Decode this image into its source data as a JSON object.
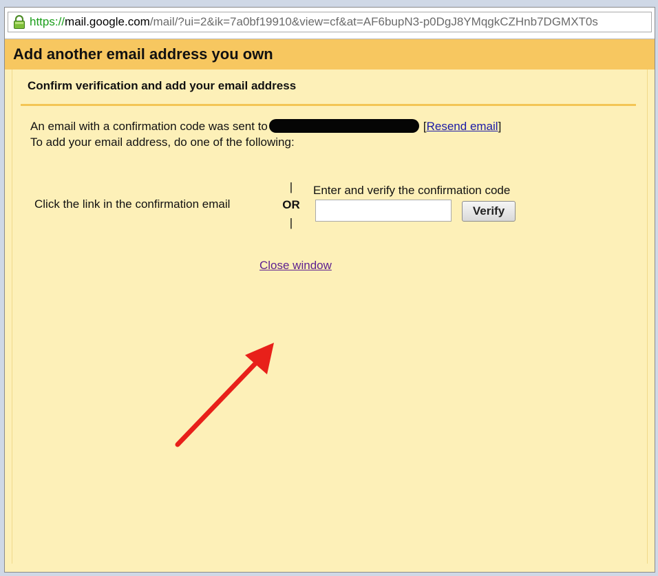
{
  "browser": {
    "url_scheme": "https",
    "url_sep": "://",
    "url_host": "mail.google.com",
    "url_rest": "/mail/?ui=2&ik=7a0bf19910&view=cf&at=AF6bupN3-p0DgJ8YMqgkCZHnb7DGMXT0s",
    "lock_icon": "padlock-icon"
  },
  "dialog": {
    "title": "Add another email address you own",
    "section_title": "Confirm verification and add your email address",
    "message_prefix": "An email with a confirmation code was sent to",
    "resend_open": "[",
    "resend_label": "Resend email",
    "resend_close": "]",
    "instructions": "To add your email address, do one of the following:",
    "option_link_text": "Click the link in the confirmation email",
    "or_bar": "|",
    "or_label": "OR",
    "option_code_text": "Enter and verify the confirmation code",
    "code_input_value": "",
    "verify_label": "Verify",
    "close_label": "Close window"
  },
  "colors": {
    "titlebar": "#f7c760",
    "background": "#fdf0b8",
    "link": "#1a1aa6",
    "visited_link": "#5c1f8f",
    "annotation_arrow": "#e8201a"
  },
  "annotation": {
    "arrow_icon": "red-arrow-icon"
  }
}
